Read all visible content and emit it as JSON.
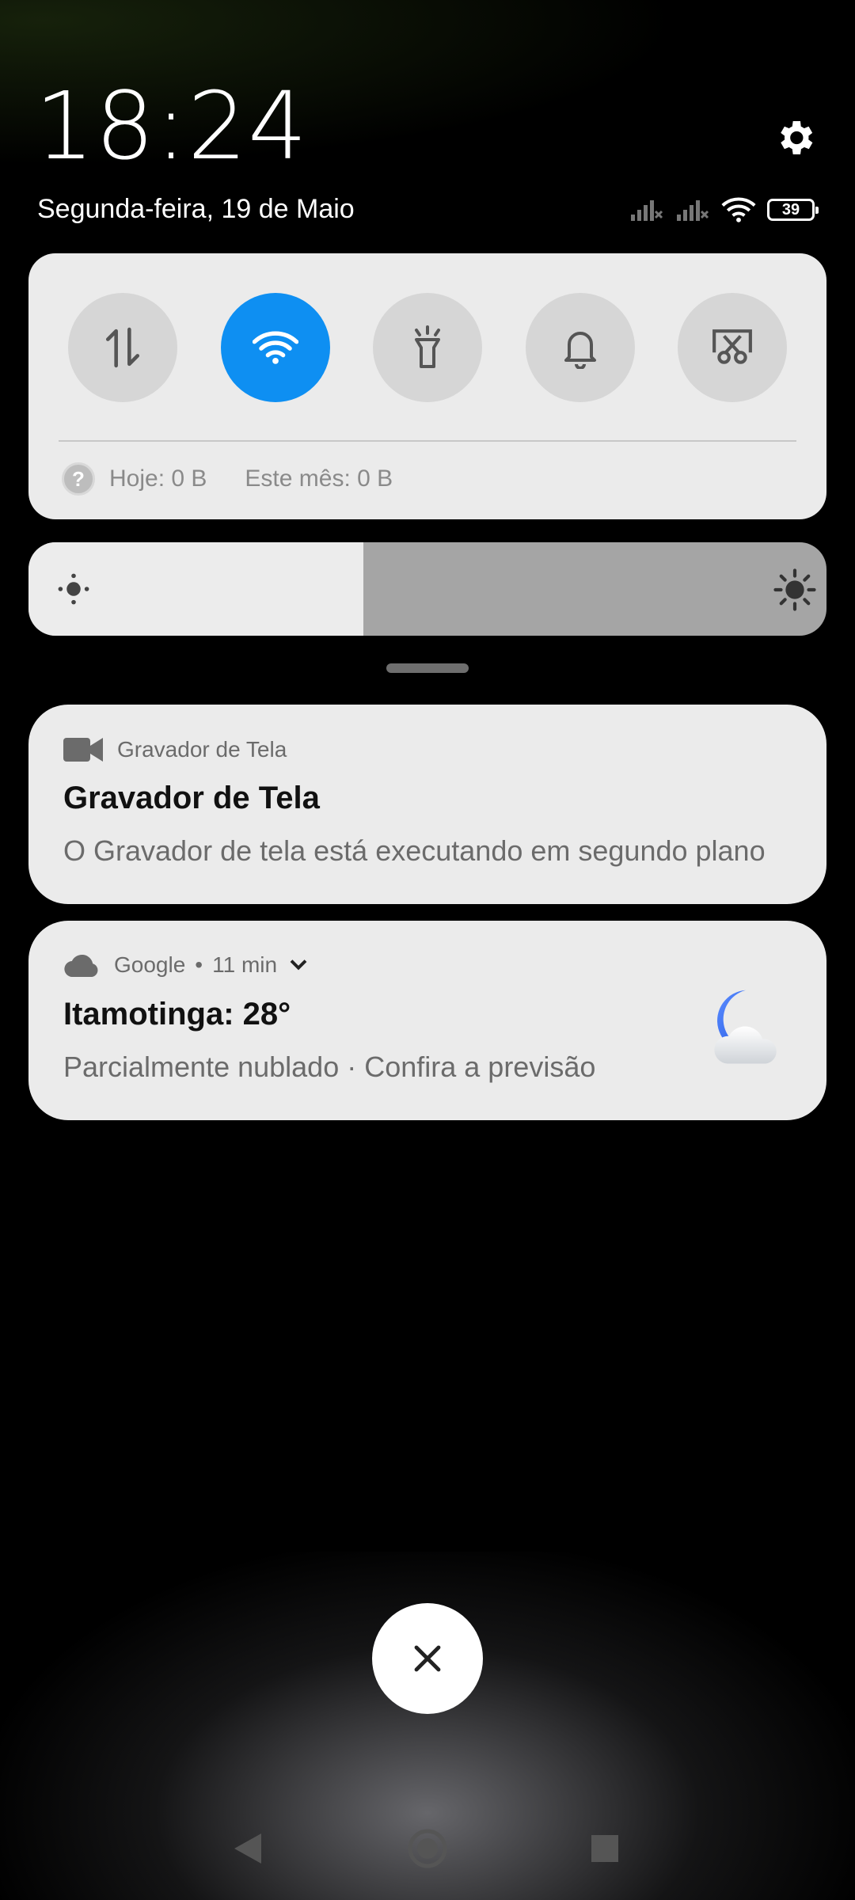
{
  "status": {
    "time": "18:24",
    "date": "Segunda-feira, 19 de Maio",
    "battery_level": "39"
  },
  "quick_settings": {
    "tiles": [
      {
        "name": "mobile-data",
        "icon": "data-arrows-icon",
        "active": false
      },
      {
        "name": "wifi",
        "icon": "wifi-icon",
        "active": true
      },
      {
        "name": "flashlight",
        "icon": "flashlight-icon",
        "active": false
      },
      {
        "name": "sound",
        "icon": "bell-icon",
        "active": false
      },
      {
        "name": "screenshot",
        "icon": "scissors-screenshot-icon",
        "active": false
      }
    ],
    "data_today": "Hoje: 0 B",
    "data_month": "Este mês: 0 B",
    "accent_color": "#0e8ff2"
  },
  "brightness": {
    "level": 0.42
  },
  "notifications": [
    {
      "app": "Gravador de Tela",
      "icon": "video-camera-icon",
      "title": "Gravador de Tela",
      "body": "O Gravador de tela está executando em segundo plano"
    },
    {
      "app": "Google",
      "icon": "cloud-icon",
      "time": "11 min",
      "title": "Itamotinga: 28°",
      "body": "Parcialmente nublado · Confira a previsão",
      "image": "moon-cloud-weather-icon"
    }
  ]
}
